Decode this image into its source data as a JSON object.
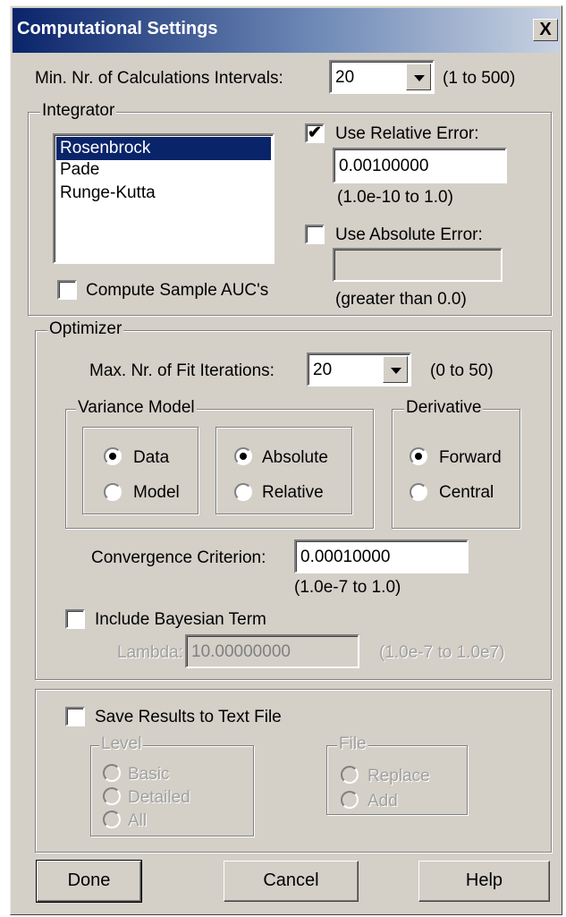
{
  "window": {
    "title": "Computational Settings",
    "close_glyph": "X"
  },
  "calc_intervals": {
    "label": "Min. Nr. of Calculations Intervals:",
    "value": "20",
    "range": "(1 to 500)"
  },
  "integrator": {
    "legend": "Integrator",
    "methods": [
      "Rosenbrock",
      "Pade",
      "Runge-Kutta"
    ],
    "selected_index": 0,
    "use_relative_error": {
      "label": "Use Relative Error:",
      "checked": true,
      "value": "0.00100000",
      "range": "(1.0e-10 to 1.0)"
    },
    "use_absolute_error": {
      "label": "Use Absolute Error:",
      "checked": false,
      "value": "",
      "range": "(greater than 0.0)"
    },
    "compute_auc": {
      "label": "Compute Sample AUC's",
      "checked": false
    }
  },
  "optimizer": {
    "legend": "Optimizer",
    "fit_iterations": {
      "label": "Max. Nr. of Fit Iterations:",
      "value": "20",
      "range": "(0 to 50)"
    },
    "variance_model": {
      "legend": "Variance Model",
      "source_options": [
        "Data",
        "Model"
      ],
      "source_selected": "Data",
      "type_options": [
        "Absolute",
        "Relative"
      ],
      "type_selected": "Absolute"
    },
    "derivative": {
      "legend": "Derivative",
      "options": [
        "Forward",
        "Central"
      ],
      "selected": "Forward"
    },
    "convergence": {
      "label": "Convergence Criterion:",
      "value": "0.00010000",
      "range": "(1.0e-7 to 1.0)"
    },
    "bayesian": {
      "label": "Include Bayesian Term",
      "checked": false
    },
    "lambda": {
      "label": "Lambda:",
      "value": "10.00000000",
      "range": "(1.0e-7 to 1.0e7)"
    }
  },
  "save_results": {
    "label": "Save Results to Text File",
    "checked": false,
    "level": {
      "legend": "Level",
      "options": [
        "Basic",
        "Detailed",
        "All"
      ]
    },
    "file": {
      "legend": "File",
      "options": [
        "Replace",
        "Add"
      ]
    }
  },
  "buttons": {
    "done": "Done",
    "cancel": "Cancel",
    "help": "Help"
  },
  "colors": {
    "title_start": "#0a246a",
    "title_end": "#c8d2e2",
    "face": "#d4d0c8",
    "selection": "#0a246a"
  }
}
